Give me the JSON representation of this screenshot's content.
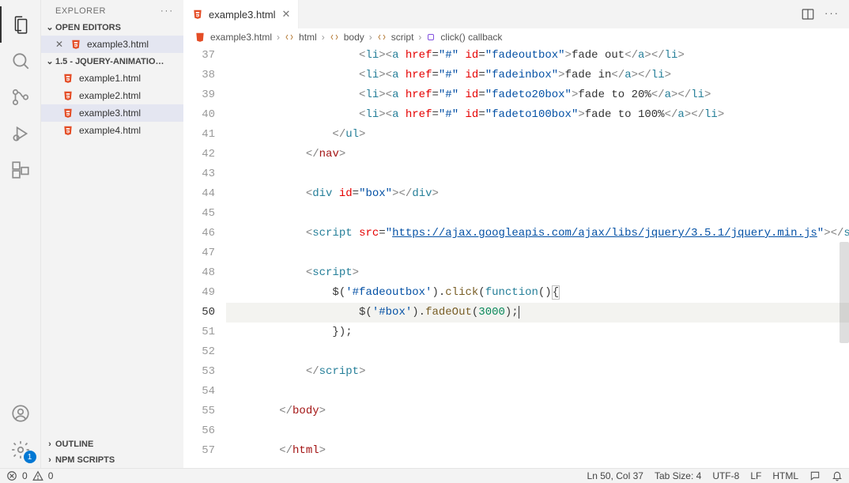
{
  "explorer": {
    "title": "EXPLORER",
    "openEditorsLabel": "OPEN EDITORS",
    "openEditors": [
      {
        "name": "example3.html"
      }
    ],
    "folderLabel": "1.5 - JQUERY-ANIMATION...",
    "files": [
      {
        "name": "example1.html",
        "active": false
      },
      {
        "name": "example2.html",
        "active": false
      },
      {
        "name": "example3.html",
        "active": true
      },
      {
        "name": "example4.html",
        "active": false
      }
    ],
    "outlineLabel": "OUTLINE",
    "npmScriptsLabel": "NPM SCRIPTS"
  },
  "tabs": [
    {
      "name": "example3.html"
    }
  ],
  "breadcrumbs": {
    "file": "example3.html",
    "p1": "html",
    "p2": "body",
    "p3": "script",
    "p4": "click() callback"
  },
  "code": {
    "startLine": 37,
    "currentLine": 50,
    "lines": {
      "37": {
        "indent": 5,
        "type": "li",
        "id": "fadeoutbox",
        "text": "fade out"
      },
      "38": {
        "indent": 5,
        "type": "li",
        "id": "fadeinbox",
        "text": "fade in"
      },
      "39": {
        "indent": 5,
        "type": "li",
        "id": "fadeto20box",
        "text": "fade to 20%"
      },
      "40": {
        "indent": 5,
        "type": "li",
        "id": "fadeto100box",
        "text": "fade to 100%"
      },
      "41": {
        "indent": 4,
        "close": "ul"
      },
      "42": {
        "indent": 3,
        "close": "nav",
        "brown": true
      },
      "43": {
        "blank": true
      },
      "44": {
        "indent": 3,
        "divline": true,
        "id": "box"
      },
      "45": {
        "blank": true
      },
      "46": {
        "indent": 3,
        "scriptsrc": "https://ajax.googleapis.com/ajax/libs/jquery/3.5.1/jquery.min.js"
      },
      "47": {
        "blank": true
      },
      "48": {
        "indent": 3,
        "open": "script"
      },
      "49": {
        "indent": 4,
        "js1": true,
        "sel": "'#fadeoutbox'",
        "fn1": "click",
        "kw": "function"
      },
      "50": {
        "indent": 5,
        "js2": true,
        "sel": "'#box'",
        "fn2": "fadeOut",
        "arg": "3000"
      },
      "51": {
        "indent": 4,
        "jsend": true
      },
      "52": {
        "blank": true
      },
      "53": {
        "indent": 3,
        "close": "script"
      },
      "54": {
        "blank": true
      },
      "55": {
        "indent": 2,
        "close": "body",
        "brown": true
      },
      "56": {
        "blank": true
      },
      "57": {
        "indent": 2,
        "close": "html",
        "brown": true
      }
    }
  },
  "status": {
    "errors": "0",
    "warnings": "0",
    "lncol": "Ln 50, Col 37",
    "tab": "Tab Size: 4",
    "enc": "UTF-8",
    "eol": "LF",
    "lang": "HTML"
  },
  "badges": {
    "settings": "1"
  }
}
